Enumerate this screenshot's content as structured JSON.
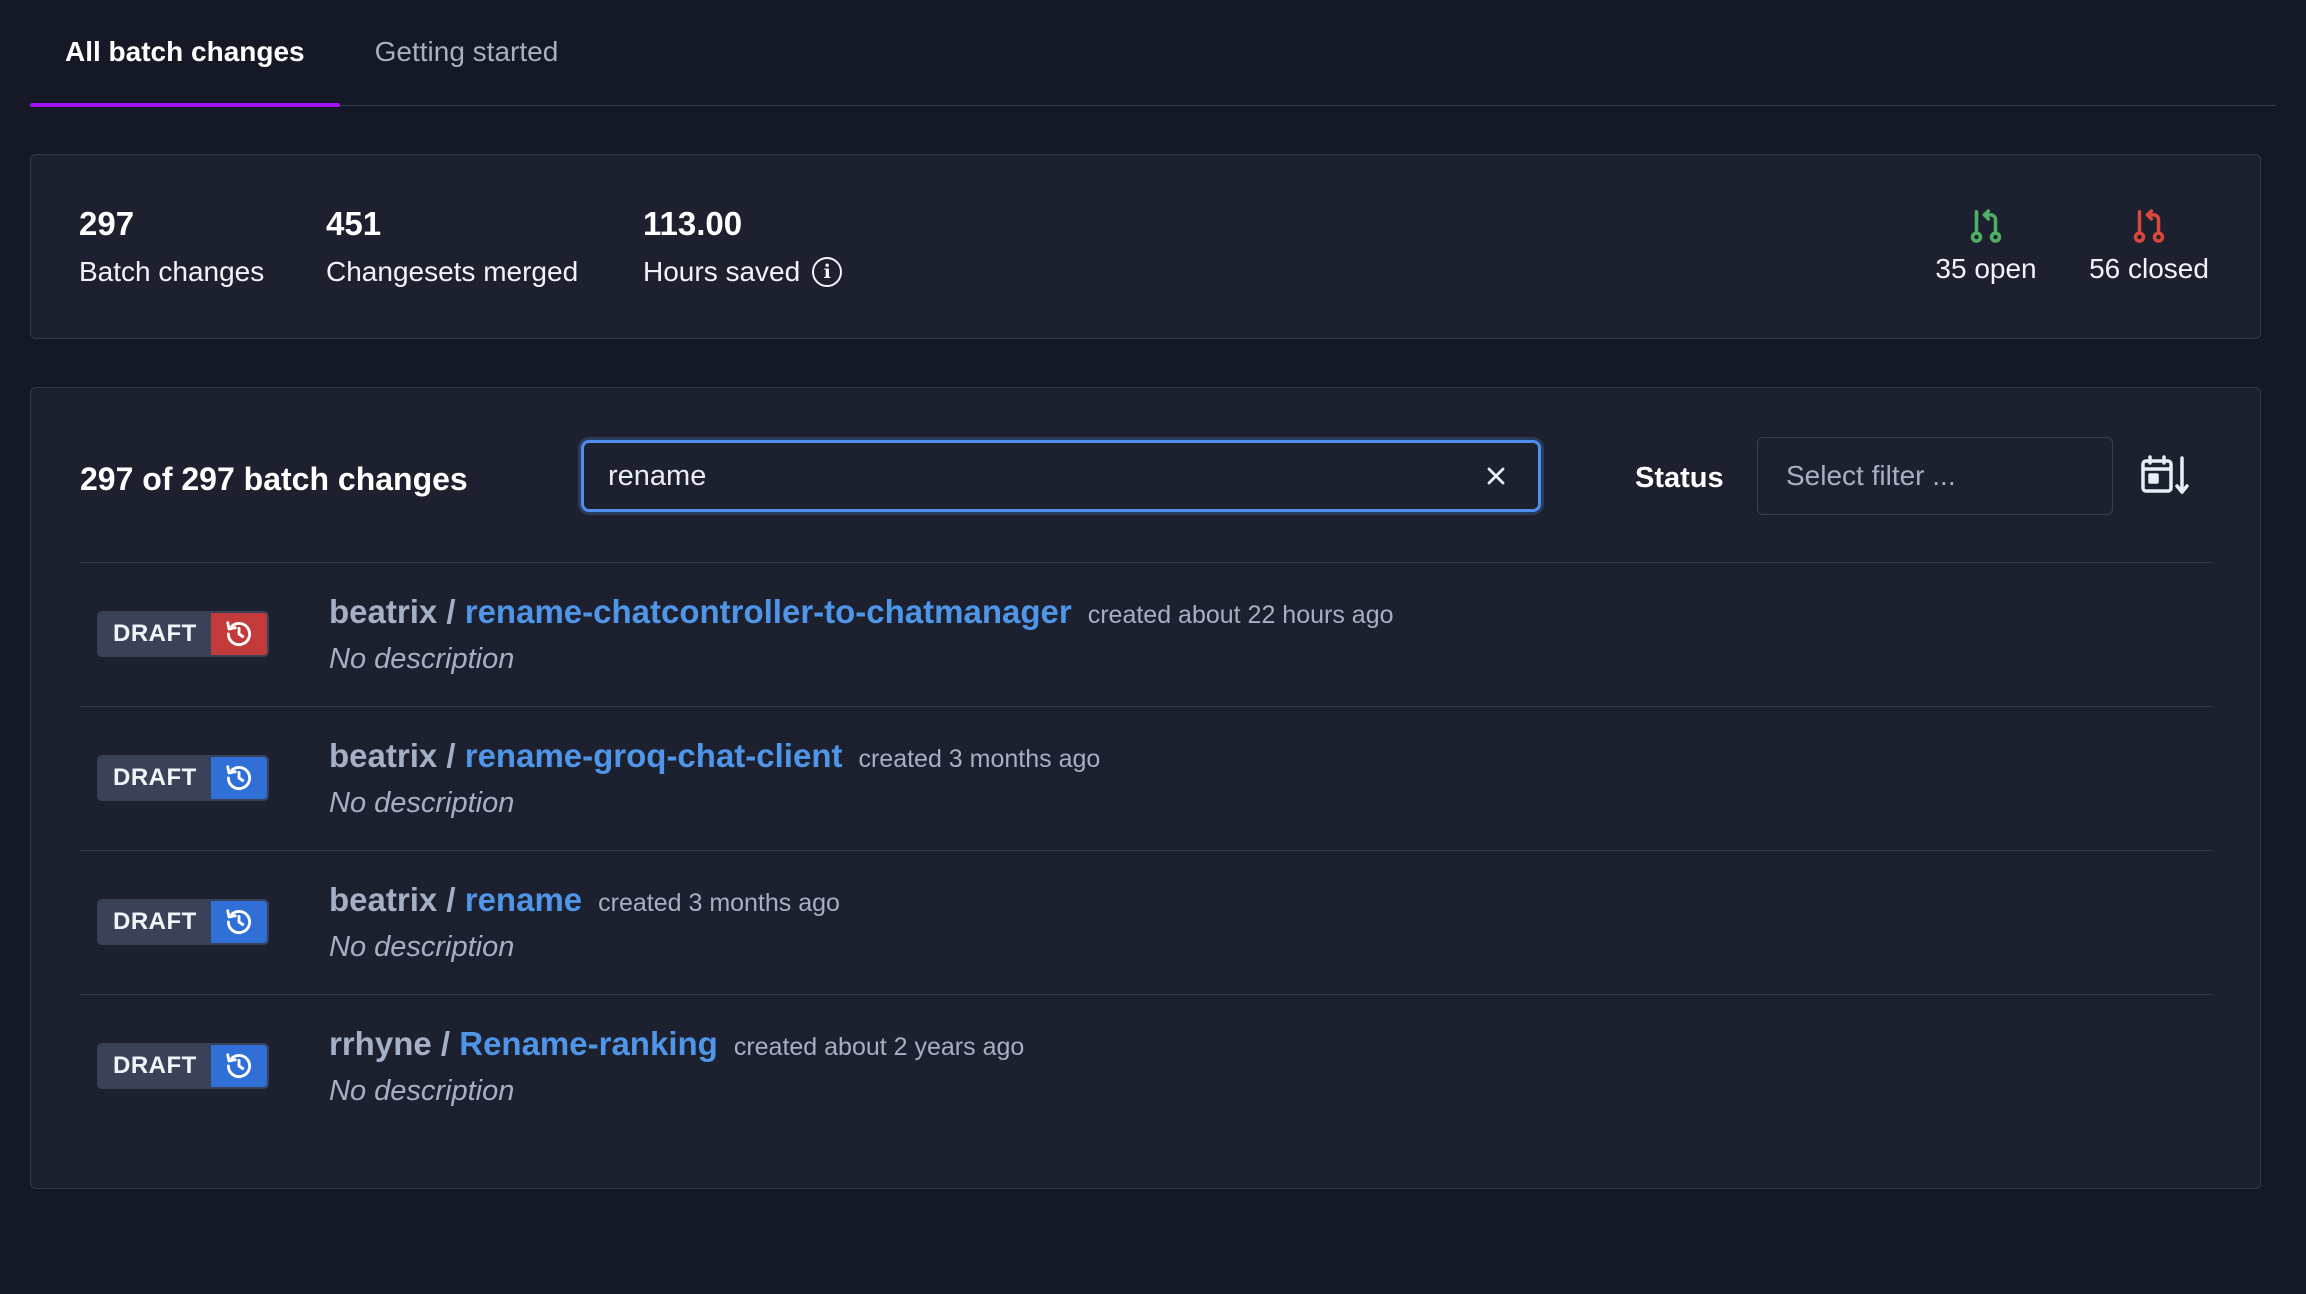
{
  "tabs": [
    {
      "label": "All batch changes",
      "active": true
    },
    {
      "label": "Getting started",
      "active": false
    }
  ],
  "stats": {
    "batch_changes": {
      "value": "297",
      "label": "Batch changes"
    },
    "changesets_merged": {
      "value": "451",
      "label": "Changesets merged"
    },
    "hours_saved": {
      "value": "113.00",
      "label": "Hours saved"
    },
    "open": {
      "label": "35 open",
      "color": "#4fb063"
    },
    "closed": {
      "label": "56 closed",
      "color": "#d9483b"
    }
  },
  "list": {
    "count_text": "297 of 297 batch changes",
    "search_value": "rename",
    "status_label": "Status",
    "status_placeholder": "Select filter ...",
    "rows": [
      {
        "state": "DRAFT",
        "icon_color": "red",
        "namespace": "beatrix",
        "name": "rename-chatcontroller-to-chatmanager",
        "created": "created about 22 hours ago",
        "description": "No description"
      },
      {
        "state": "DRAFT",
        "icon_color": "blue",
        "namespace": "beatrix",
        "name": "rename-groq-chat-client",
        "created": "created 3 months ago",
        "description": "No description"
      },
      {
        "state": "DRAFT",
        "icon_color": "blue",
        "namespace": "beatrix",
        "name": "rename",
        "created": "created 3 months ago",
        "description": "No description"
      },
      {
        "state": "DRAFT",
        "icon_color": "blue",
        "namespace": "rrhyne",
        "name": "Rename-ranking",
        "created": "created about 2 years ago",
        "description": "No description"
      }
    ]
  },
  "colors": {
    "accent": "#a112ff",
    "link": "#4f95e8",
    "badge_red": "#c23a3a",
    "badge_blue": "#2f6fd6"
  }
}
